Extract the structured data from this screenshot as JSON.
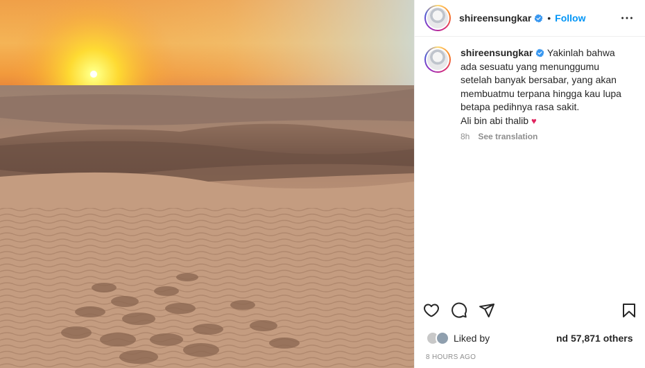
{
  "post": {
    "username": "shireensungkar",
    "verified": true,
    "follow_label": "Follow",
    "dot": "•"
  },
  "caption": {
    "username": "shireensungkar",
    "text": "Yakinlah bahwa ada sesuatu yang menunggumu setelah banyak bersabar, yang akan membuatmu terpana hingga kau lupa betapa pedihnya rasa sakit.",
    "line2": "Ali bin abi thalib",
    "heart": "♥",
    "age": "8h",
    "see_translation": "See translation"
  },
  "likes": {
    "prefix": "Liked by",
    "count_text": "nd 57,871 others"
  },
  "timestamp": "8 HOURS AGO",
  "colors": {
    "accent": "#0095f6",
    "text": "#262626",
    "muted": "#8e8e8e",
    "verified": "#3897f0"
  },
  "icons": [
    "more-icon",
    "verified-icon",
    "heart-icon",
    "comment-icon",
    "share-icon",
    "save-icon"
  ]
}
